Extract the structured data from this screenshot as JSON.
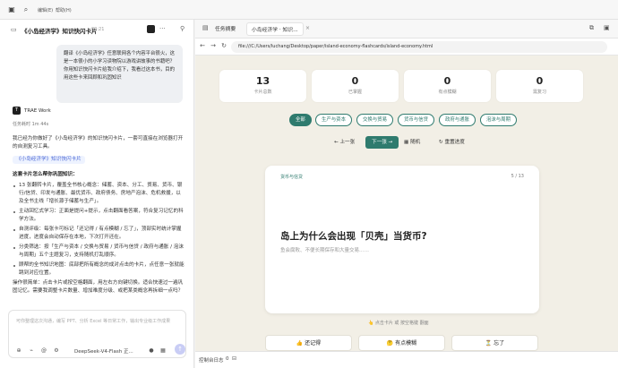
{
  "topbar": {
    "menu_items": [
      "编辑(E)",
      "帮助(H)"
    ]
  },
  "chat": {
    "title": "《小岛经济学》知识快闪卡片",
    "time": "09:21",
    "user_message": "翻译《小岛经济学》任意联网各个内容平台很火，这是一本很小的小学习读物院以游戏讲故事的书籍吧？你用知识快闪卡片给我介绍下，我看过这本书，目的用这些卡来回顾和巩固知识",
    "agent_name": "TRAE Work",
    "task_time": "任务耗时 1m 44s",
    "response_intro": "我已经为你做好了《小岛经济学》的知识快闪卡片，一套可直接在浏览器打开的自测复习工具。",
    "file_tag": "《小岛经济学》知识快闪卡片",
    "response_heading": "这套卡片怎么帮你巩固知识：",
    "bullets": [
      "13 张翻转卡片，覆盖全书核心概念：储蓄、资本、分工、贸易、货币、银行/信贷、印发与通胀、最优货币、政府债务、房地产泡沫、危机救援，以及全书主线「增长源于储蓄与生产」。",
      "主动回忆式学习：正面是提问+提示，点击翻面看答案，符合复习记忆的科学方法。",
      "自测评级：每张卡可标记「还记得 / 有点模糊 / 忘了」，顶部实时统计掌握进度，进度会自动保存在本地，下次打开还在。",
      "分类筛选：按「生产与资本 / 交换与贸易 / 货币与信贷 / 政府与通胀 / 泡沫与周期」五个主题复习，支持随机打乱顺序。",
      "顾帮的全书知识地图：底部把所有概念的成对点击的卡片，点任意一张就能跳到对应位置。"
    ],
    "response_outro": "操作很简单：点击卡片或按空格翻面，用左右方向键切换。适合快速过一遍巩固记忆。需要我调整卡片数量、增加难度分级、或把某类概念再拆细一点吗？",
    "input_placeholder": "可你整理这次沟通，编写 PPT、分析 Excel 等日常工作，输出专业级工作成果",
    "model_name": "DeepSeek-V4-Flash 正..."
  },
  "browser": {
    "tabs": [
      "任务摘要",
      "小岛经济学 · 知识..."
    ],
    "url": "file:///C:/Users/luchang/Desktop/paper/island-economy-flashcards/island-economy.html",
    "status_label": "控制台日志",
    "status_count": "0"
  },
  "flashcards": {
    "stats": [
      {
        "value": "13",
        "label": "卡片总数"
      },
      {
        "value": "0",
        "label": "已掌握"
      },
      {
        "value": "0",
        "label": "有点模糊"
      },
      {
        "value": "0",
        "label": "需复习"
      }
    ],
    "categories": [
      "全部",
      "生产与资本",
      "交换与贸易",
      "货币与信贷",
      "政府与通胀",
      "泡沫与周期"
    ],
    "controls": {
      "prev": "← 上一张",
      "next": "下一张 →",
      "shuffle": "随机",
      "reset": "重置进度"
    },
    "card": {
      "category": "货币与信贷",
      "count": "5 / 13",
      "question": "岛上为什么会出现「贝壳」当货币?",
      "hint": "鱼会腐败、不便长期保存和大量交易……"
    },
    "flip_hint": "👆 点击卡片 或 按空格键 翻面",
    "mark_buttons": [
      "👍 还记得",
      "🤔 有点模糊",
      "⏳ 忘了"
    ],
    "accent_color": "#2f7b6e"
  }
}
